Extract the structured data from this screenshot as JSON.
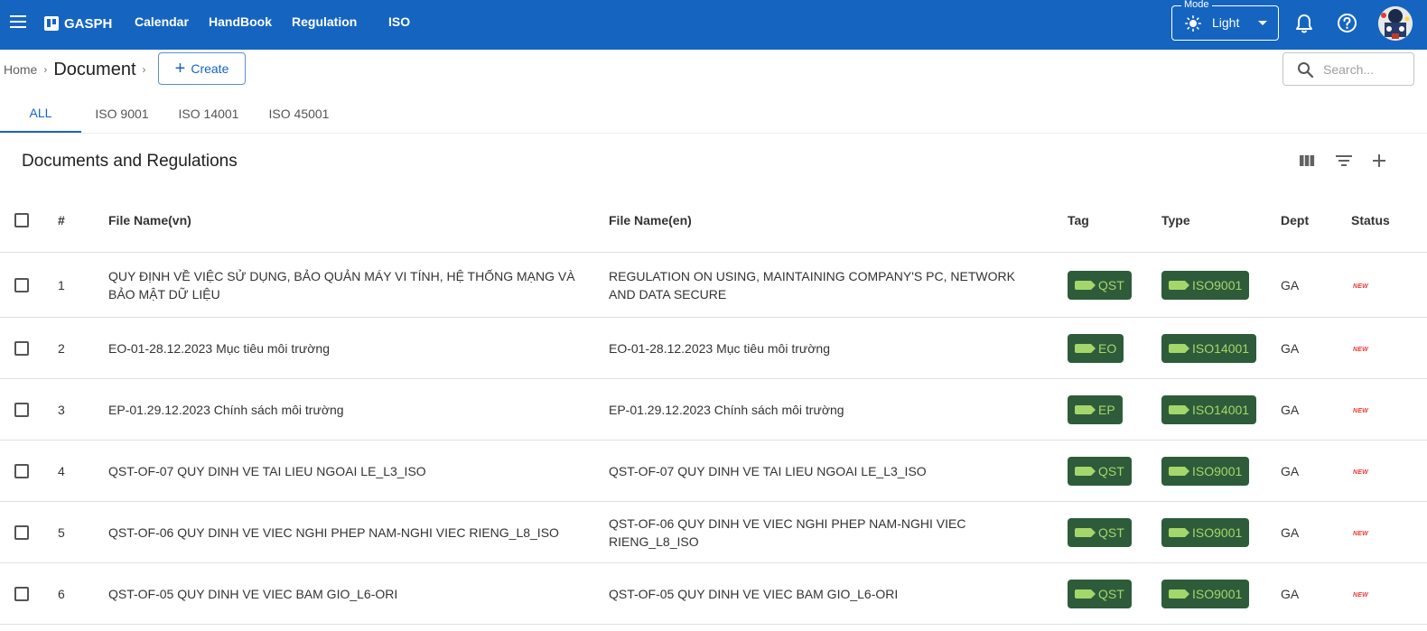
{
  "appbar": {
    "brand": "GASPH",
    "nav": [
      "Calendar",
      "HandBook",
      "Regulation",
      "ISO"
    ],
    "mode_label": "Mode",
    "mode_value": "Light"
  },
  "breadcrumb": {
    "home": "Home",
    "current": "Document"
  },
  "create_label": "Create",
  "search": {
    "placeholder": "Search..."
  },
  "tabs": [
    "ALL",
    "ISO 9001",
    "ISO 14001",
    "ISO 45001"
  ],
  "section_title": "Documents and Regulations",
  "table": {
    "columns": [
      "#",
      "File Name(vn)",
      "File Name(en)",
      "Tag",
      "Type",
      "Dept",
      "Status"
    ],
    "rows": [
      {
        "no": "1",
        "name_vn": "QUY ĐỊNH VỀ VIỆC SỬ DỤNG, BẢO QUẢN MÁY VI TÍNH, HỆ THỐNG MẠNG VÀ BẢO MẬT DỮ LIỆU",
        "name_en": "REGULATION ON USING, MAINTAINING COMPANY'S PC, NETWORK AND DATA SECURE",
        "tag": "QST",
        "type": "ISO9001",
        "dept": "GA",
        "status": "NEW"
      },
      {
        "no": "2",
        "name_vn": "EO-01-28.12.2023 Mục tiêu môi trường",
        "name_en": "EO-01-28.12.2023 Mục tiêu môi trường",
        "tag": "EO",
        "type": "ISO14001",
        "dept": "GA",
        "status": "NEW"
      },
      {
        "no": "3",
        "name_vn": "EP-01.29.12.2023 Chính sách môi trường",
        "name_en": "EP-01.29.12.2023 Chính sách môi trường",
        "tag": "EP",
        "type": "ISO14001",
        "dept": "GA",
        "status": "NEW"
      },
      {
        "no": "4",
        "name_vn": "QST-OF-07 QUY DINH VE TAI LIEU NGOAI LE_L3_ISO",
        "name_en": "QST-OF-07 QUY DINH VE TAI LIEU NGOAI LE_L3_ISO",
        "tag": "QST",
        "type": "ISO9001",
        "dept": "GA",
        "status": "NEW"
      },
      {
        "no": "5",
        "name_vn": "QST-OF-06 QUY DINH VE VIEC NGHI PHEP NAM-NGHI VIEC RIENG_L8_ISO",
        "name_en": "QST-OF-06 QUY DINH VE VIEC NGHI PHEP NAM-NGHI VIEC RIENG_L8_ISO",
        "tag": "QST",
        "type": "ISO9001",
        "dept": "GA",
        "status": "NEW"
      },
      {
        "no": "6",
        "name_vn": "QST-OF-05 QUY DINH VE VIEC BAM GIO_L6-ORI",
        "name_en": "QST-OF-05 QUY DINH VE VIEC BAM GIO_L6-ORI",
        "tag": "QST",
        "type": "ISO9001",
        "dept": "GA",
        "status": "NEW"
      }
    ]
  }
}
